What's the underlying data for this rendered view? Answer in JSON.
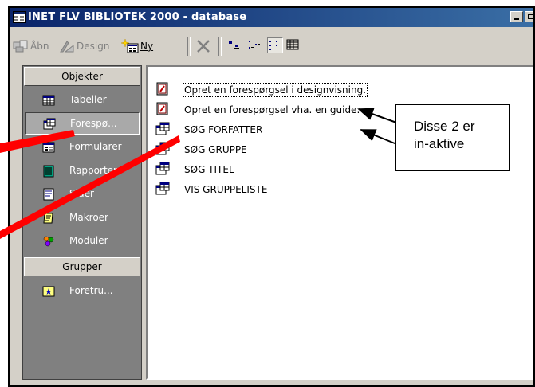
{
  "window": {
    "title": "INET FLV BIBLIOTEK 2000 - database"
  },
  "toolbar": {
    "open_label": "Åbn",
    "design_label": "Design",
    "new_label": "Ny"
  },
  "sidebar": {
    "objects_header": "Objekter",
    "groups_header": "Grupper",
    "items": [
      {
        "label": "Tabeller",
        "icon": "table-icon"
      },
      {
        "label": "Forespø...",
        "icon": "query-icon",
        "selected": true
      },
      {
        "label": "Formularer",
        "icon": "form-icon"
      },
      {
        "label": "Rapporter",
        "icon": "report-icon"
      },
      {
        "label": "Sider",
        "icon": "page-icon"
      },
      {
        "label": "Makroer",
        "icon": "macro-icon"
      },
      {
        "label": "Moduler",
        "icon": "module-icon"
      }
    ],
    "groups": [
      {
        "label": "Foretru...",
        "icon": "favorites-icon"
      }
    ]
  },
  "list": {
    "items": [
      {
        "label": "Opret en forespørgsel i designvisning.",
        "icon": "wizard-icon"
      },
      {
        "label": "Opret en forespørgsel vha. en guide.",
        "icon": "wizard-icon"
      },
      {
        "label": "SØG FORFATTER",
        "icon": "query-icon"
      },
      {
        "label": "SØG GRUPPE",
        "icon": "query-icon"
      },
      {
        "label": "SØG TITEL",
        "icon": "query-icon"
      },
      {
        "label": "VIS GRUPPELISTE",
        "icon": "query-icon"
      }
    ]
  },
  "annotation": {
    "line1": "Disse 2 er",
    "line2": "in-aktive"
  },
  "colors": {
    "titlebar_start": "#0a246a",
    "titlebar_end": "#3a6ea5",
    "face": "#d4d0c8",
    "sidebar_bg": "#808080",
    "annotation_line": "#ff0000"
  }
}
